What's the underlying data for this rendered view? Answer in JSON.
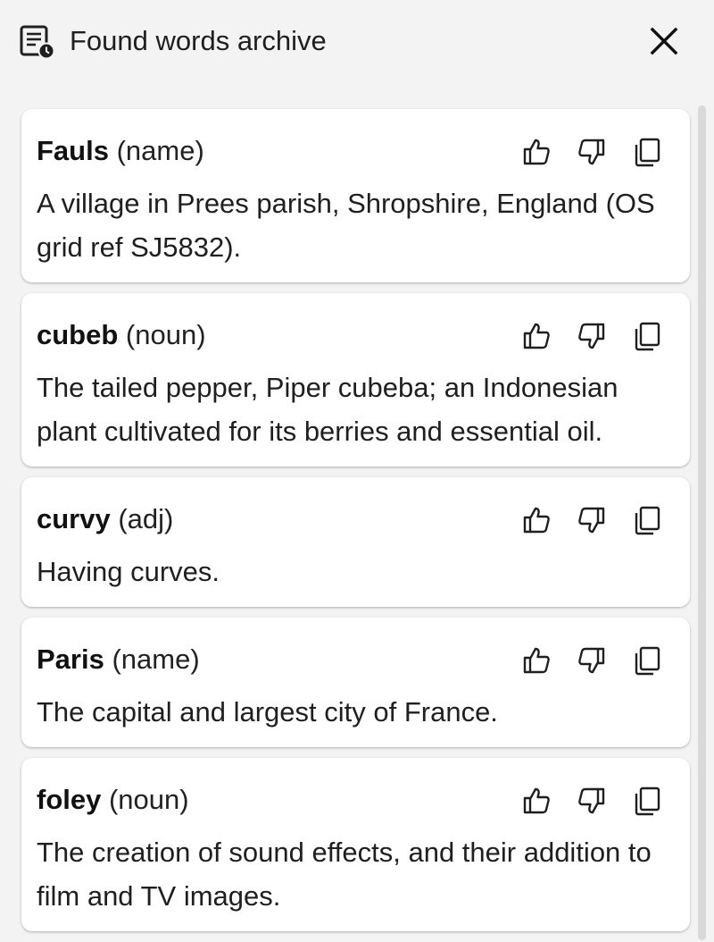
{
  "header": {
    "title": "Found words archive",
    "icon": "archive-list-clock-icon",
    "close_icon": "close-icon"
  },
  "entries": [
    {
      "word": "Fauls",
      "pos": "(name)",
      "definition": "A village in Prees parish, Shropshire, England (OS grid ref SJ5832)."
    },
    {
      "word": "cubeb",
      "pos": "(noun)",
      "definition": "The tailed pepper, Piper cubeba; an Indonesian plant cultivated for its berries and essential oil."
    },
    {
      "word": "curvy",
      "pos": "(adj)",
      "definition": "Having curves."
    },
    {
      "word": "Paris",
      "pos": "(name)",
      "definition": "The capital and largest city of France."
    },
    {
      "word": "foley",
      "pos": "(noun)",
      "definition": "The creation of sound effects, and their addition to film and TV images."
    }
  ],
  "actions": {
    "like_icon": "thumb-up-icon",
    "dislike_icon": "thumb-down-icon",
    "copy_icon": "copy-icon"
  },
  "colors": {
    "background": "#f3f3f3",
    "card": "#ffffff",
    "text": "#1f1f1f"
  }
}
